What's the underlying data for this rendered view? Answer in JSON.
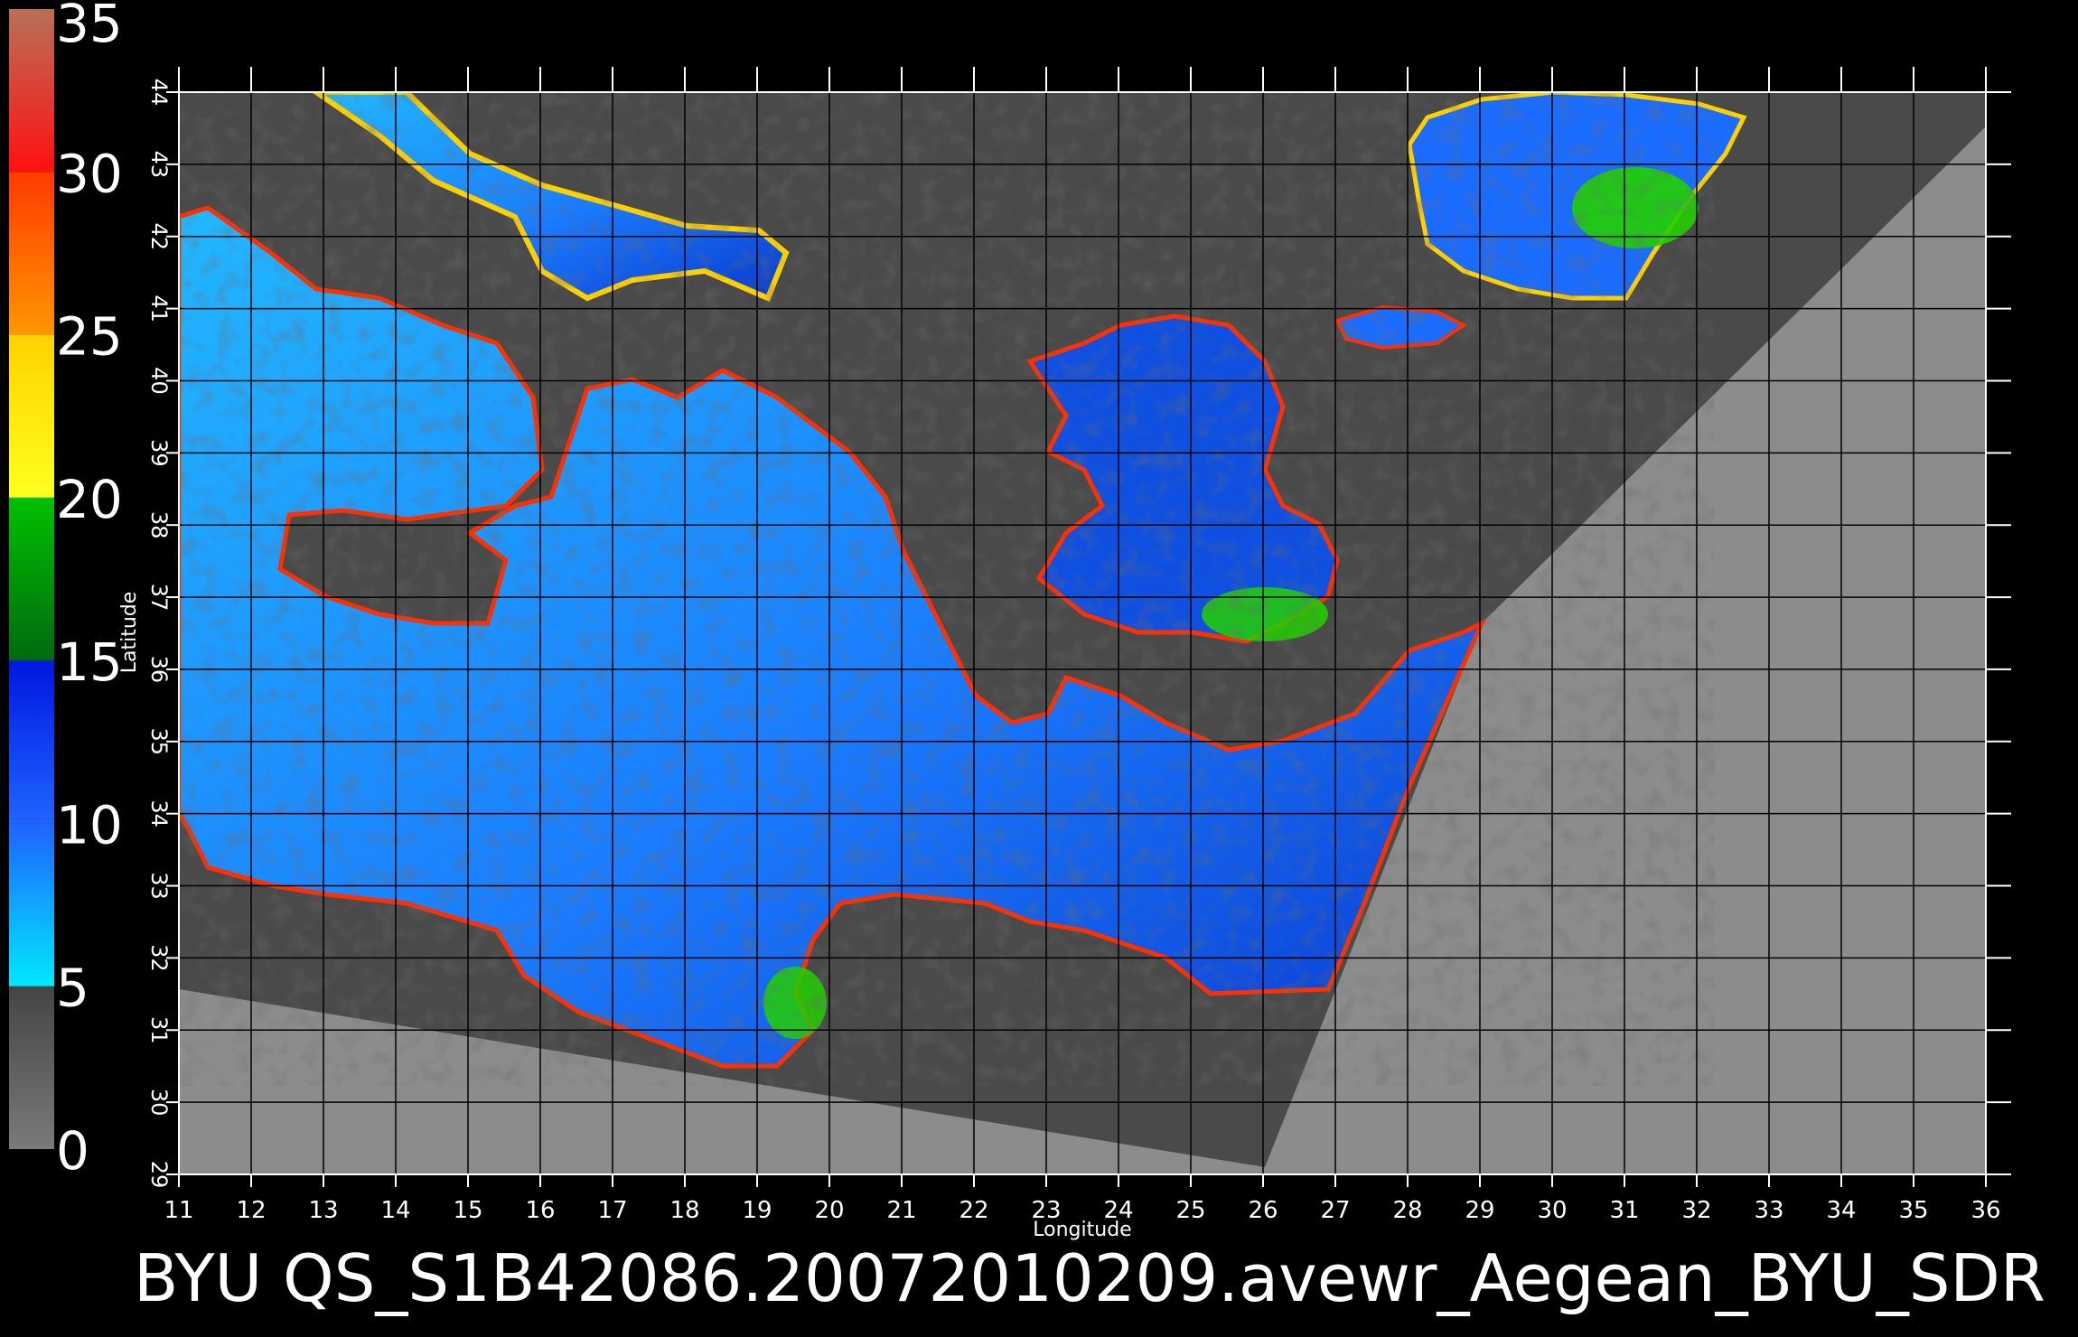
{
  "map": {
    "caption": "BYU  QS_S1B42086.20072010209.avewr_Aegean_BYU_SDR",
    "x_axis_title": "Longitude",
    "y_axis_title": "Latitude",
    "lon_ticks": [
      "11",
      "12",
      "13",
      "14",
      "15",
      "16",
      "17",
      "18",
      "19",
      "20",
      "21",
      "22",
      "23",
      "24",
      "25",
      "26",
      "27",
      "28",
      "29",
      "30",
      "31",
      "32",
      "33",
      "34",
      "35",
      "36"
    ],
    "lat_ticks": [
      "29",
      "30",
      "31",
      "32",
      "33",
      "34",
      "35",
      "36",
      "37",
      "38",
      "39",
      "40",
      "41",
      "42",
      "43",
      "44"
    ],
    "lon_range": [
      11,
      36
    ],
    "lat_range": [
      29,
      44
    ],
    "colorbar": {
      "labels": [
        "0",
        "5",
        "10",
        "15",
        "20",
        "25",
        "30",
        "35"
      ],
      "range": [
        0,
        35
      ],
      "segments": [
        {
          "from": 0,
          "to": 5,
          "top_color": "#444444",
          "bottom_color": "#7a7a7a"
        },
        {
          "from": 5,
          "to": 10,
          "top_color": "#1f64ff",
          "bottom_color": "#00e8ff"
        },
        {
          "from": 10,
          "to": 15,
          "top_color": "#0018e0",
          "bottom_color": "#1f64ff"
        },
        {
          "from": 15,
          "to": 20,
          "top_color": "#00c000",
          "bottom_color": "#006a10"
        },
        {
          "from": 20,
          "to": 25,
          "top_color": "#ffd200",
          "bottom_color": "#ffff20"
        },
        {
          "from": 25,
          "to": 30,
          "top_color": "#ff3a00",
          "bottom_color": "#ff9600"
        },
        {
          "from": 30,
          "to": 35,
          "top_color": "#b87058",
          "bottom_color": "#ff1010"
        }
      ]
    },
    "colors": {
      "background": "#000000",
      "land": "#4a4a4a",
      "no_data": "#8c8c8c",
      "ocean_light": "#22a8ff",
      "ocean_dark": "#0a3ad0",
      "high_wind": "#22d000",
      "coast_warm": "#ff3000",
      "coast_yellow": "#ffe000"
    }
  }
}
